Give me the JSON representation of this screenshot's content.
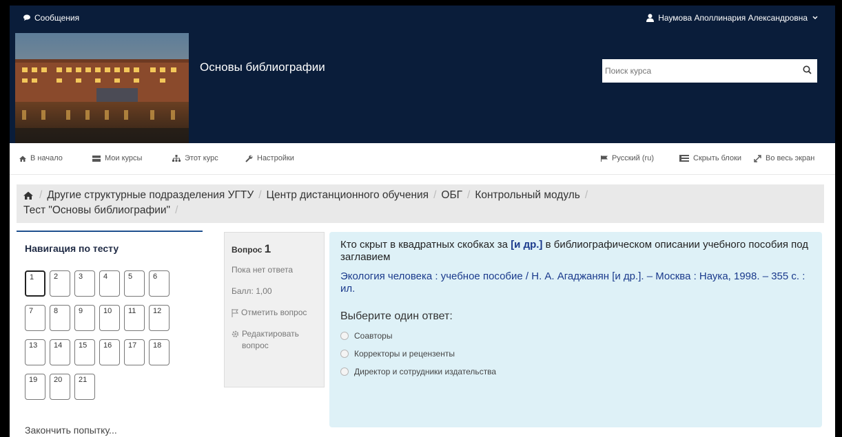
{
  "topbar": {
    "messages": "Сообщения",
    "user": "Наумова Аполлинария Александровна"
  },
  "header": {
    "course_title": "Основы библиографии",
    "search_placeholder": "Поиск курса"
  },
  "nav": {
    "home": "В начало",
    "my_courses": "Мои курсы",
    "this_course": "Этот курс",
    "settings": "Настройки",
    "language": "Русский (ru)",
    "hide_blocks": "Скрыть блоки",
    "fullscreen": "Во весь экран"
  },
  "breadcrumb": [
    "Другие структурные подразделения УГТУ",
    "Центр дистанционного обучения",
    "ОБГ",
    "Контрольный модуль",
    "Тест \"Основы библиографии\""
  ],
  "quiz_nav": {
    "title": "Навигация по тесту",
    "questions": [
      "1",
      "2",
      "3",
      "4",
      "5",
      "6",
      "7",
      "8",
      "9",
      "10",
      "11",
      "12",
      "13",
      "14",
      "15",
      "16",
      "17",
      "18",
      "19",
      "20",
      "21"
    ],
    "current": "1",
    "finish": "Закончить попытку..."
  },
  "question_info": {
    "label": "Вопрос",
    "number": "1",
    "status": "Пока нет ответа",
    "score": "Балл: 1,00",
    "flag": "Отметить вопрос",
    "edit": "Редактировать вопрос"
  },
  "question": {
    "text_before": "Кто скрыт в квадратных скобках за ",
    "highlight": "[и др.]",
    "text_after": " в библиографическом описании учебного пособия под заглавием",
    "bibliography": "Экология человека : учебное  пособие / Н. А. Агаджанян [и др.]. – Москва : Наука, 1998. – 355 с. : ил.",
    "prompt": "Выберите один ответ:",
    "options": [
      "Соавторы",
      "Корректоры и рецензенты",
      "Директор и сотрудники издательства"
    ]
  },
  "colors": {
    "header_bg": "#0a1d3a",
    "question_bg": "#def1f7",
    "link": "#1a3a8c"
  }
}
